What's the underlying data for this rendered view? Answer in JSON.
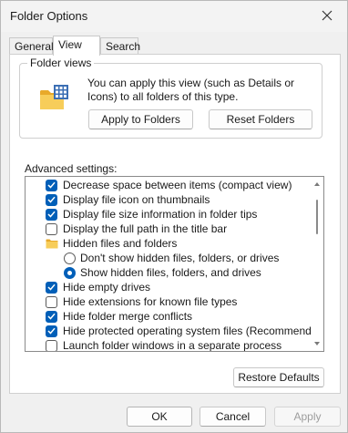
{
  "window": {
    "title": "Folder Options"
  },
  "tabs": [
    {
      "label": "General"
    },
    {
      "label": "View"
    },
    {
      "label": "Search"
    }
  ],
  "folder_views": {
    "legend": "Folder views",
    "description": "You can apply this view (such as Details or Icons) to all folders of this type.",
    "apply_button": "Apply to Folders",
    "reset_button": "Reset Folders"
  },
  "advanced": {
    "label": "Advanced settings:",
    "items": [
      {
        "kind": "checkbox",
        "checked": true,
        "label": "Decrease space between items (compact view)"
      },
      {
        "kind": "checkbox",
        "checked": true,
        "label": "Display file icon on thumbnails"
      },
      {
        "kind": "checkbox",
        "checked": true,
        "label": "Display file size information in folder tips"
      },
      {
        "kind": "checkbox",
        "checked": false,
        "label": "Display the full path in the title bar"
      },
      {
        "kind": "folder",
        "label": "Hidden files and folders"
      },
      {
        "kind": "radio",
        "checked": false,
        "label": "Don't show hidden files, folders, or drives"
      },
      {
        "kind": "radio",
        "checked": true,
        "label": "Show hidden files, folders, and drives"
      },
      {
        "kind": "checkbox",
        "checked": true,
        "label": "Hide empty drives"
      },
      {
        "kind": "checkbox",
        "checked": false,
        "label": "Hide extensions for known file types"
      },
      {
        "kind": "checkbox",
        "checked": true,
        "label": "Hide folder merge conflicts"
      },
      {
        "kind": "checkbox",
        "checked": true,
        "label": "Hide protected operating system files (Recommended)"
      },
      {
        "kind": "checkbox",
        "checked": false,
        "label": "Launch folder windows in a separate process"
      }
    ]
  },
  "buttons": {
    "restore_defaults": "Restore Defaults",
    "ok": "OK",
    "cancel": "Cancel",
    "apply": "Apply"
  },
  "colors": {
    "accent": "#005fb8",
    "folder_yellow": "#f2c14a",
    "disabled_text": "#9d9d9d"
  }
}
